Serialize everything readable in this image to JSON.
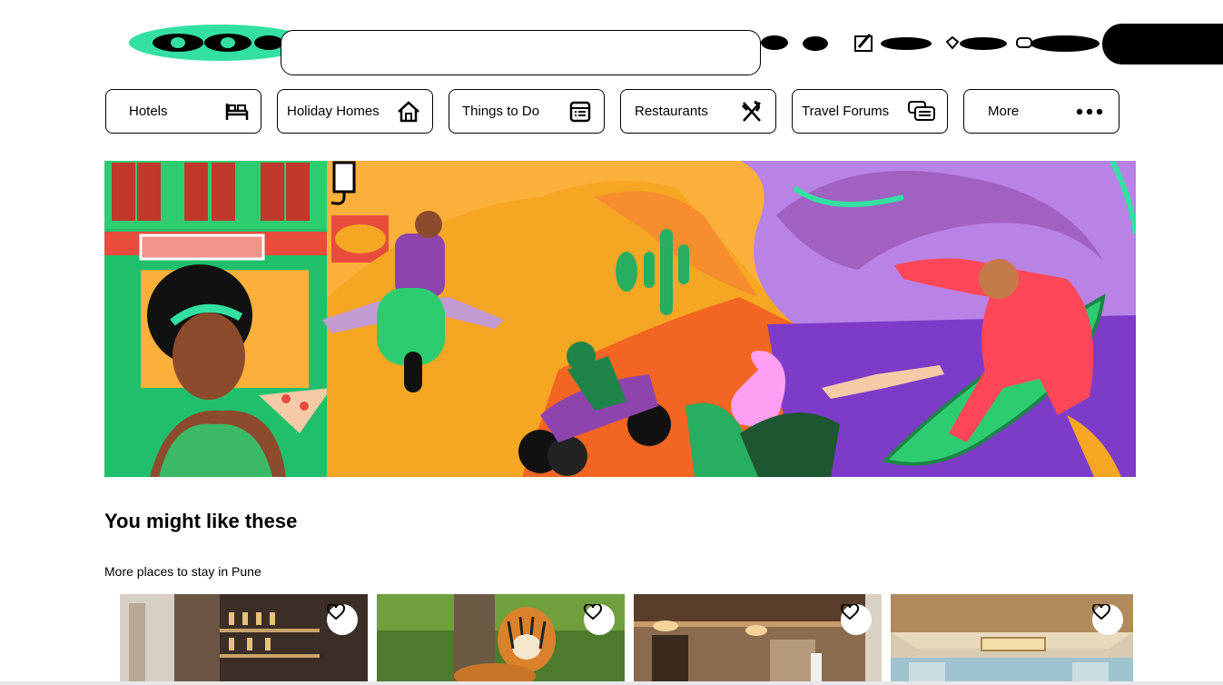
{
  "nav": {
    "items": [
      {
        "label": "Hotels",
        "icon": "bed-icon"
      },
      {
        "label": "Holiday Homes",
        "icon": "house-icon"
      },
      {
        "label": "Things to Do",
        "icon": "ticket-list-icon"
      },
      {
        "label": "Restaurants",
        "icon": "fork-knife-icon"
      },
      {
        "label": "Travel Forums",
        "icon": "chat-bubbles-icon"
      },
      {
        "label": "More",
        "icon": "more-dots-icon"
      }
    ]
  },
  "search": {
    "placeholder": ""
  },
  "section": {
    "title": "You might like these",
    "subtitle": "More places to stay in Pune"
  },
  "cards": [
    {
      "image": "hotel-bar-photo"
    },
    {
      "image": "tiger-photo"
    },
    {
      "image": "restaurant-interior-photo"
    },
    {
      "image": "hotel-ceiling-photo"
    }
  ],
  "colors": {
    "brand": "#34e0a1",
    "text": "#000000",
    "background": "#ffffff"
  }
}
